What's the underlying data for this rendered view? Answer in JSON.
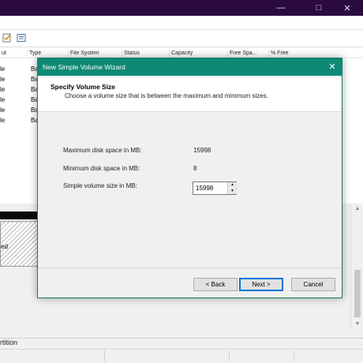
{
  "background_window": {
    "window_controls": {
      "minimize": "—",
      "maximize": "□",
      "close": "✕"
    },
    "columns": [
      "ut",
      "Type",
      "File System",
      "Status",
      "Capacity",
      "Free Spa...",
      "% Free"
    ],
    "rows": [
      {
        "layout": "le",
        "type": "Ba"
      },
      {
        "layout": "le",
        "type": "Ba"
      },
      {
        "layout": "le",
        "type": "Ba"
      },
      {
        "layout": "le",
        "type": "Ba"
      },
      {
        "layout": "le",
        "type": "Ba"
      },
      {
        "layout": "le",
        "type": "Ba"
      }
    ],
    "disk_partition_label": "ed",
    "legend_label": "rtition"
  },
  "wizard": {
    "title": "New Simple Volume Wizard",
    "close_glyph": "✕",
    "heading": "Specify Volume Size",
    "subheading": "Choose a volume size that is between the maximum and minimum sizes.",
    "fields": {
      "max_label": "Maximum disk space in MB:",
      "max_value": "15998",
      "min_label": "Minimum disk space in MB:",
      "min_value": "8",
      "size_label": "Simple volume size in MB:",
      "size_value": "15998"
    },
    "buttons": {
      "back": "< Back",
      "next": "Next >",
      "cancel": "Cancel"
    }
  },
  "colors": {
    "background_titlebar": "#2b0b3f",
    "wizard_titlebar": "#0e8a74",
    "default_button_border": "#0078d7"
  }
}
